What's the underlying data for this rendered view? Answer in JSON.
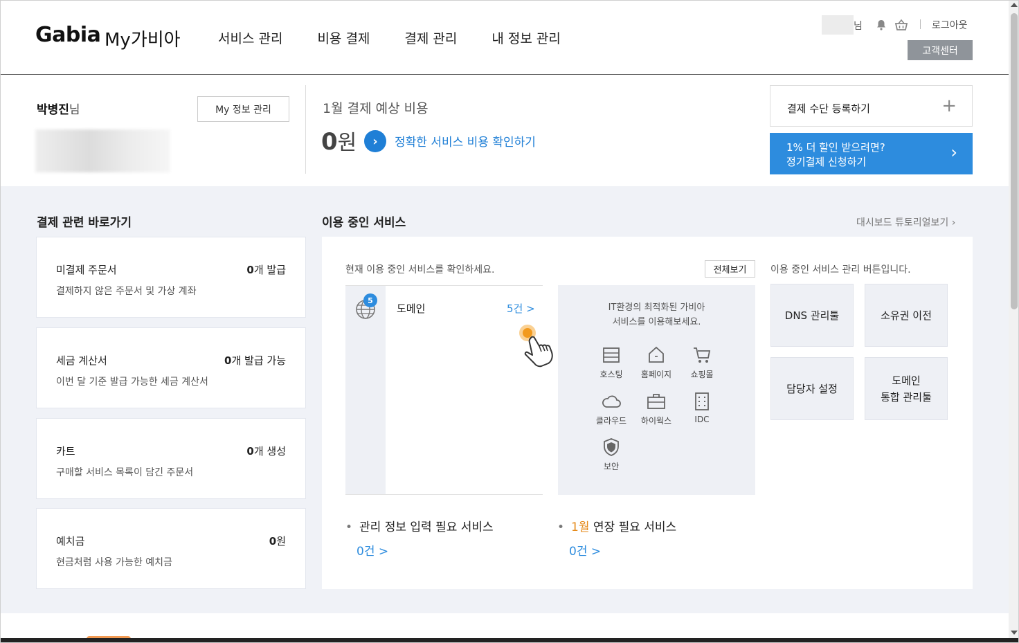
{
  "header": {
    "logo": "Gabia",
    "logo_sub": "My가비아",
    "nav": [
      "서비스 관리",
      "비용 결제",
      "결제 관리",
      "내 정보 관리"
    ],
    "user_suffix": "님",
    "logout": "로그아웃",
    "support": "고객센터",
    "icons": [
      "bell-icon",
      "basket-icon"
    ]
  },
  "summary": {
    "user_name": "박병진",
    "user_suffix": "님",
    "my_info_button": "My 정보 관리",
    "payment_label": "1월 결제 예상 비용",
    "payment_amount": "0",
    "payment_unit": "원",
    "payment_link": "정확한 서비스 비용 확인하기",
    "register_label": "결제 수단 등록하기",
    "register_icon": "+",
    "promo_line1": "1% 더 할인 받으려면?",
    "promo_line2": "정기결제 신청하기",
    "promo_arrow": "›"
  },
  "shortcuts": {
    "title": "결제 관련 바로가기",
    "cards": [
      {
        "title": "미결제 주문서",
        "count": "0",
        "suffix": "개 발급",
        "desc": "결제하지 않은 주문서 및 가상 계좌"
      },
      {
        "title": "세금 계산서",
        "count": "0",
        "suffix": "개 발급 가능",
        "desc": "이번 달 기준 발급 가능한 세금 계산서"
      },
      {
        "title": "카트",
        "count": "0",
        "suffix": "개 생성",
        "desc": "구매할 서비스 목록이 담긴 주문서"
      },
      {
        "title": "예치금",
        "count": "0",
        "suffix": "원",
        "desc": "현금처럼 사용 가능한 예치금"
      }
    ]
  },
  "services": {
    "title": "이용 중인 서비스",
    "tutorial": "대시보드 튜토리얼보기 ›",
    "hint": "현재 이용 중인 서비스를 확인하세요.",
    "view_all": "전체보기",
    "mgmt_hint": "이용 중인 서비스 관리 버튼입니다.",
    "domain": {
      "badge": "5",
      "name": "도메인",
      "count": "5건 >"
    },
    "it_text_line1": "IT환경의 최적화된 가비아",
    "it_text_line2": "서비스를 이용해보세요.",
    "it_items": [
      "호스팅",
      "홈페이지",
      "쇼핑몰",
      "클라우드",
      "하이웍스",
      "IDC",
      "보안"
    ],
    "mgmt_buttons": [
      "DNS 관리툴",
      "소유권 이전",
      "담당자 설정",
      "도메인\n통합 관리툴"
    ],
    "manage_needed_label": "관리 정보 입력 필요 서비스",
    "manage_needed_count": "0건 >",
    "renew_month": "1월",
    "renew_label": " 연장 필요 서비스",
    "renew_count": "0건 >"
  },
  "colors": {
    "accent": "#2d8cde",
    "link": "#1f7fd6",
    "month": "#e58a1a",
    "panel_bg": "#f0f2f7"
  }
}
